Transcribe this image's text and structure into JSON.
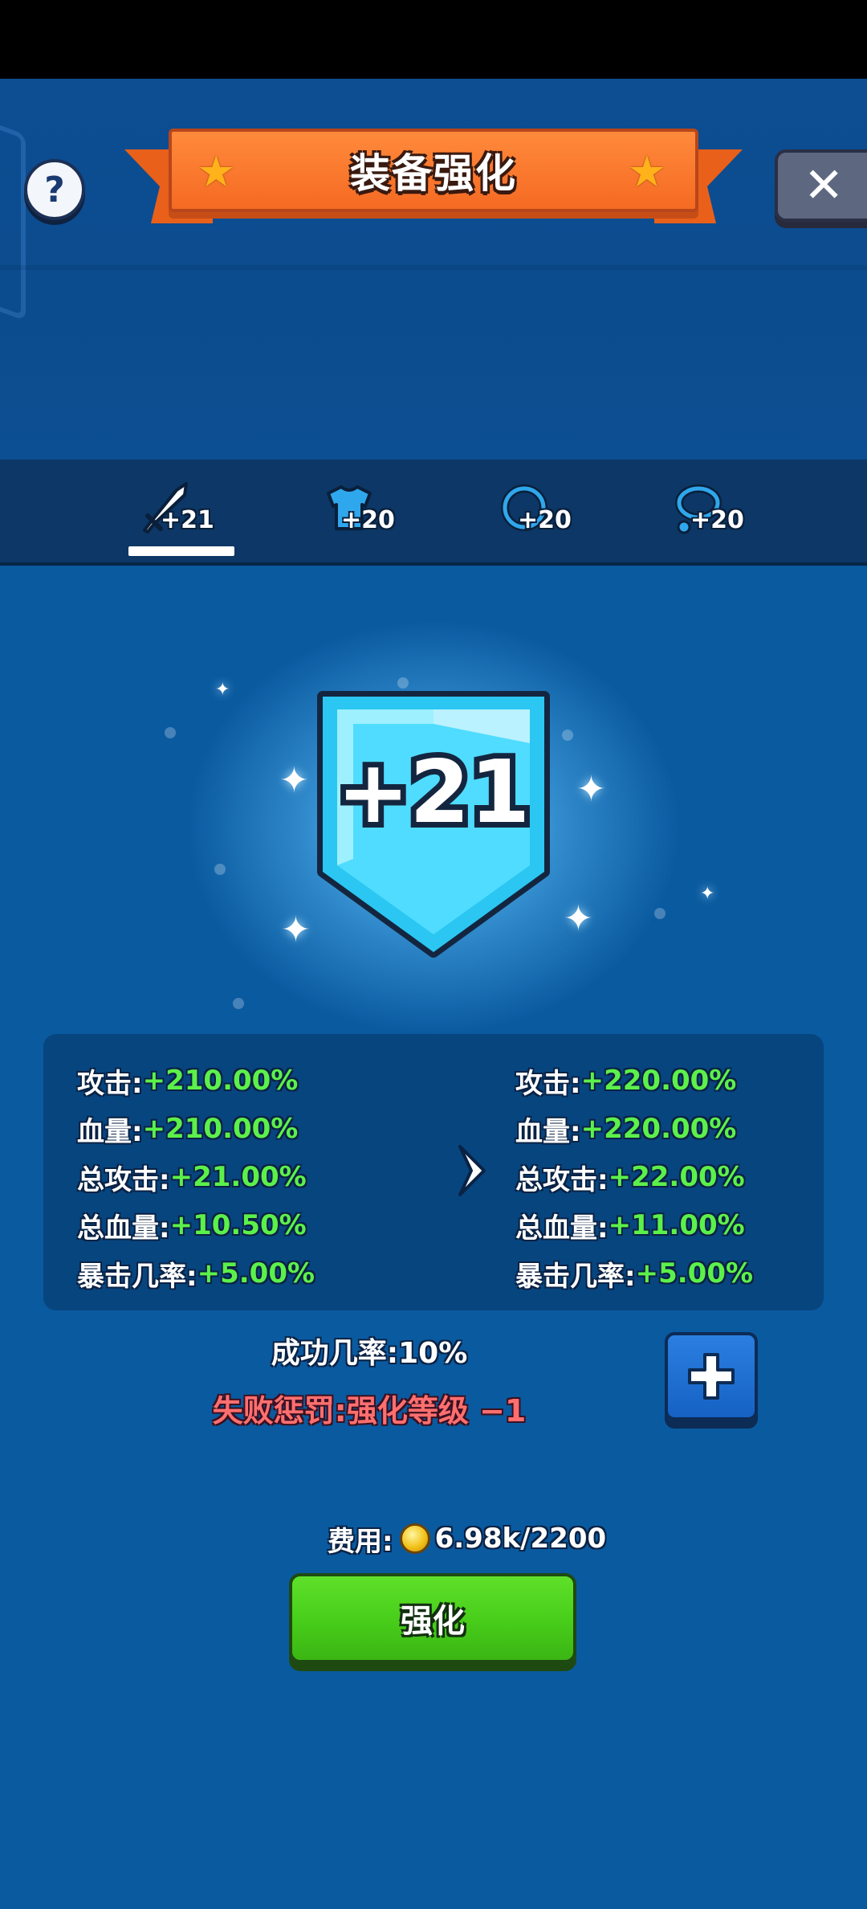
{
  "header": {
    "title": "装备强化",
    "help_label": "?",
    "close_label": "✕"
  },
  "tabs": [
    {
      "icon": "sword-icon",
      "level": "+21",
      "active": true
    },
    {
      "icon": "armor-icon",
      "level": "+20",
      "active": false
    },
    {
      "icon": "ring-icon",
      "level": "+20",
      "active": false
    },
    {
      "icon": "necklace-icon",
      "level": "+20",
      "active": false
    }
  ],
  "badge": {
    "level": "+21"
  },
  "stats": {
    "current": [
      {
        "label": "攻击:",
        "value": "+210.00%"
      },
      {
        "label": "血量:",
        "value": "+210.00%"
      },
      {
        "label": "总攻击:",
        "value": "+21.00%"
      },
      {
        "label": "总血量:",
        "value": "+10.50%"
      },
      {
        "label": "暴击几率:",
        "value": "+5.00%"
      }
    ],
    "next": [
      {
        "label": "攻击:",
        "value": "+220.00%"
      },
      {
        "label": "血量:",
        "value": "+220.00%"
      },
      {
        "label": "总攻击:",
        "value": "+22.00%"
      },
      {
        "label": "总血量:",
        "value": "+11.00%"
      },
      {
        "label": "暴击几率:",
        "value": "+5.00%"
      }
    ]
  },
  "success_text": "成功几率:10%",
  "penalty_text": "失败惩罚:强化等级 −1",
  "cost": {
    "label": "费用:",
    "value": "6.98k/2200"
  },
  "upgrade_label": "强化",
  "colors": {
    "accent_green": "#5cf14a",
    "penalty_red": "#ff6f6f",
    "ribbon_orange": "#f56a22",
    "button_green": "#49cf1b"
  }
}
